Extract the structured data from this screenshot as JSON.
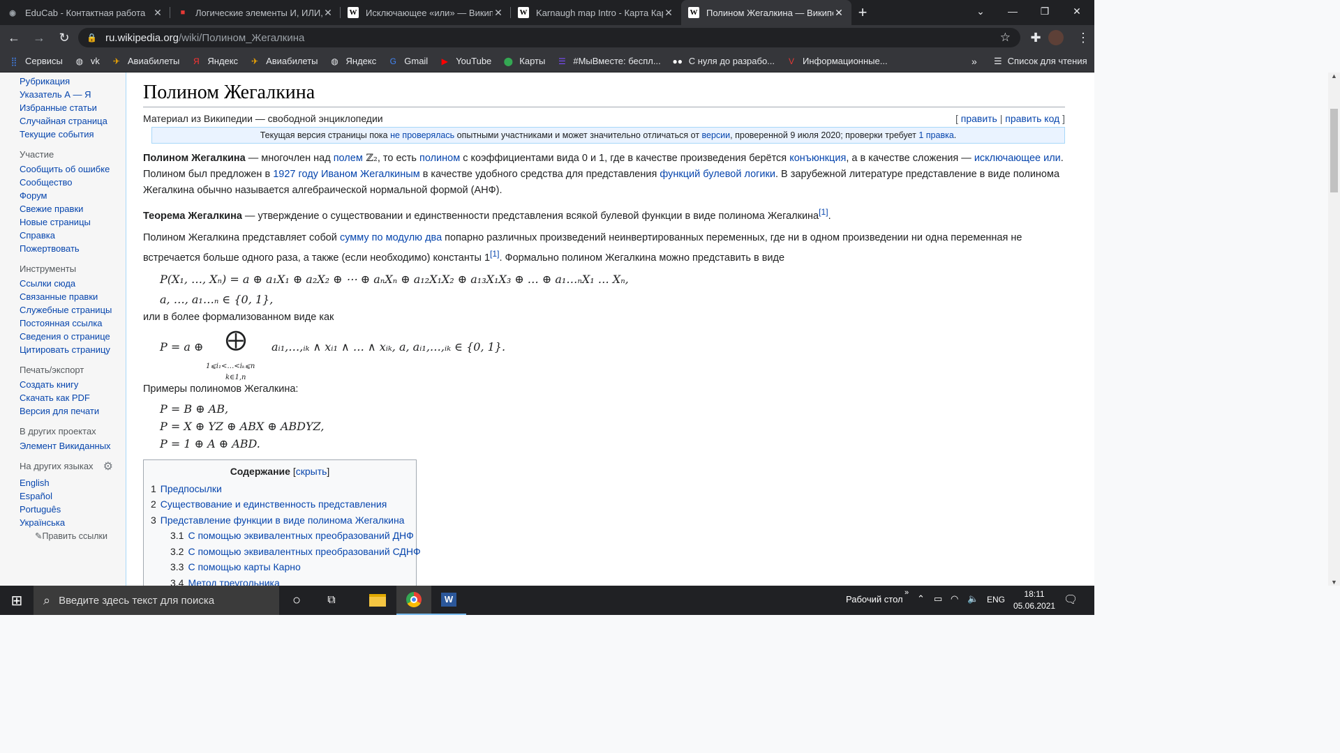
{
  "browser": {
    "tabs": [
      {
        "title": "EduCab - Контактная работа",
        "icon": "educab-icon",
        "color": "#9aa0a6",
        "glyph": "◉"
      },
      {
        "title": "Логические элементы И, ИЛИ, I",
        "icon": "pdf-red-icon",
        "color": "#e53935",
        "glyph": "■"
      },
      {
        "title": "Исключающее «или» — Википе",
        "icon": "wikipedia-icon",
        "color": "#ffffff",
        "glyph": "W"
      },
      {
        "title": "Karnaugh map Intro - Карта Карн",
        "icon": "wikipedia-icon",
        "color": "#ffffff",
        "glyph": "W"
      },
      {
        "title": "Полином Жегалкина — Википе,",
        "icon": "wikipedia-icon",
        "color": "#ffffff",
        "glyph": "W"
      }
    ],
    "url_domain": "ru.wikipedia.org",
    "url_path": "/wiki/Полином_Жегалкина",
    "bookmarks": [
      {
        "label": "Сервисы",
        "icon": "apps-grid-icon",
        "glyph": "⣿",
        "color": "#4285f4"
      },
      {
        "label": "vk",
        "icon": "globe-icon",
        "glyph": "◍",
        "color": "#e8eaed"
      },
      {
        "label": "Авиабилеты",
        "icon": "plane-icon",
        "glyph": "✈",
        "color": "#f9ab00"
      },
      {
        "label": "Яндекс",
        "icon": "yandex-icon",
        "glyph": "Я",
        "color": "#ff3333"
      },
      {
        "label": "Авиабилеты",
        "icon": "plane-icon",
        "glyph": "✈",
        "color": "#f9ab00"
      },
      {
        "label": "Яндекс",
        "icon": "globe-icon",
        "glyph": "◍",
        "color": "#e8eaed"
      },
      {
        "label": "Gmail",
        "icon": "google-icon",
        "glyph": "G",
        "color": "#4285f4"
      },
      {
        "label": "YouTube",
        "icon": "youtube-icon",
        "glyph": "▶",
        "color": "#ff0000"
      },
      {
        "label": "Карты",
        "icon": "maps-pin-icon",
        "glyph": "⬤",
        "color": "#34a853"
      },
      {
        "label": "#МыВместе: беспл...",
        "icon": "list-icon",
        "glyph": "☰",
        "color": "#7c4dff"
      },
      {
        "label": "С нуля до разрабо...",
        "icon": "medium-icon",
        "glyph": "●●",
        "color": "#ffffff"
      },
      {
        "label": "Информационные...",
        "icon": "v-icon",
        "glyph": "V",
        "color": "#e53935"
      }
    ],
    "reading_list": "Список для чтения"
  },
  "sidebar": {
    "top_items": [
      "Рубрикация",
      "Указатель А — Я",
      "Избранные статьи",
      "Случайная страница",
      "Текущие события"
    ],
    "sections": [
      {
        "heading": "Участие",
        "items": [
          "Сообщить об ошибке",
          "Сообщество",
          "Форум",
          "Свежие правки",
          "Новые страницы",
          "Справка",
          "Пожертвовать"
        ]
      },
      {
        "heading": "Инструменты",
        "items": [
          "Ссылки сюда",
          "Связанные правки",
          "Служебные страницы",
          "Постоянная ссылка",
          "Сведения о странице",
          "Цитировать страницу"
        ]
      },
      {
        "heading": "Печать/экспорт",
        "items": [
          "Создать книгу",
          "Скачать как PDF",
          "Версия для печати"
        ]
      },
      {
        "heading": "В других проектах",
        "items": [
          "Элемент Викиданных"
        ]
      }
    ],
    "lang_heading": "На других языках",
    "languages": [
      "English",
      "Español",
      "Português",
      "Українська"
    ],
    "edit_links": "Править ссылки"
  },
  "article": {
    "title": "Полином Жегалкина",
    "from": "Материал из Википедии — свободной энциклопедии",
    "edit": "править",
    "edit_code": "править код",
    "notice_a": "Текущая версия страницы пока ",
    "notice_link1": "не проверялась",
    "notice_b": " опытными участниками и может значительно отличаться от ",
    "notice_link2": "версии",
    "notice_c": ", проверенной 9 июля 2020; проверки требует ",
    "notice_link3": "1 правка",
    "p1_bold": "Полином Жегалкина",
    "p1_a": " — многочлен над ",
    "p1_l1": "полем",
    "p1_m": " ℤ₂",
    "p1_b": ", то есть ",
    "p1_l2": "полином",
    "p1_c": " с коэффициентами вида 0 и 1, где в качестве произведения берётся ",
    "p1_l3": "конъюнкция",
    "p1_d": ", а в качестве сложения — ",
    "p1_l4": "исключающее или",
    "p1_e": ". Полином был предложен в ",
    "p1_l5": "1927 году",
    "p1_f": " ",
    "p1_l6": "Иваном Жегалкиным",
    "p1_g": " в качестве удобного средства для представления ",
    "p1_l7": "функций булевой логики",
    "p1_h": ". В зарубежной литературе представление в виде полинома Жегалкина обычно называется алгебраической нормальной формой (АНФ).",
    "p2_bold": "Теорема Жегалкина",
    "p2_a": " — утверждение о существовании и единственности представления всякой булевой функции в виде полинома Жегалкина",
    "ref1": "[1]",
    "p3_a": "Полином Жегалкина представляет собой ",
    "p3_l1": "сумму по модулю два",
    "p3_b": " попарно различных произведений неинвертированных переменных, где ни в одном произведении ни одна переменная не встречается больше одного раза, а также (если необходимо) константы 1",
    "p3_c": ". Формально полином Жегалкина можно представить в виде",
    "math1": "P(X₁, …, Xₙ) = a ⊕ a₁X₁ ⊕ a₂X₂ ⊕ ⋯ ⊕ aₙXₙ ⊕ a₁₂X₁X₂ ⊕ a₁₃X₁X₃ ⊕ … ⊕ a₁…ₙX₁ … Xₙ,",
    "math2": "a, …, a₁…ₙ ∈ {0, 1},",
    "p4": "или в более формализованном виде как",
    "math3_a": "P = a ⊕",
    "math3_big": "⨁",
    "math3_sub1": "1⩽i₁<…<iₖ⩽n",
    "math3_sub2": "k∈1,n",
    "math3_b": "aᵢ₁,…,ᵢₖ ∧ xᵢ₁ ∧ … ∧ xᵢₖ,    a, aᵢ₁,…,ᵢₖ ∈ {0, 1}.",
    "p5": "Примеры полиномов Жегалкина:",
    "examples": [
      "P = B ⊕ AB,",
      "P = X ⊕ YZ ⊕ ABX ⊕ ABDYZ,",
      "P = 1 ⊕ A ⊕ ABD."
    ]
  },
  "toc": {
    "title": "Содержание",
    "hide": "скрыть",
    "items": [
      {
        "num": "1",
        "label": "Предпосылки",
        "level": 1
      },
      {
        "num": "2",
        "label": "Существование и единственность представления",
        "level": 1
      },
      {
        "num": "3",
        "label": "Представление функции в виде полинома Жегалкина",
        "level": 1
      },
      {
        "num": "3.1",
        "label": "С помощью эквивалентных преобразований ДНФ",
        "level": 2
      },
      {
        "num": "3.2",
        "label": "С помощью эквивалентных преобразований СДНФ",
        "level": 2
      },
      {
        "num": "3.3",
        "label": "С помощью карты Карно",
        "level": 2
      },
      {
        "num": "3.4",
        "label": "Метод треугольника",
        "level": 2
      }
    ]
  },
  "taskbar": {
    "search_placeholder": "Введите здесь текст для поиска",
    "desktop": "Рабочий стол",
    "lang": "ENG",
    "time": "18:11",
    "date": "05.06.2021"
  }
}
